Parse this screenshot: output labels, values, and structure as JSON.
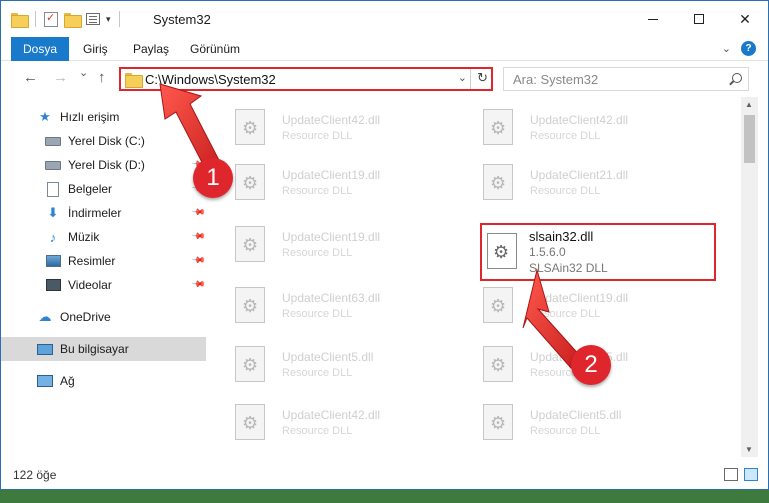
{
  "window": {
    "title": "System32",
    "controls": {
      "minimize": "",
      "maximize": "",
      "close": "✕"
    }
  },
  "ribbon": {
    "tabs": [
      "Dosya",
      "Giriş",
      "Paylaş",
      "Görünüm"
    ],
    "help": "?"
  },
  "navigation": {
    "back": "←",
    "forward": "→",
    "recent": "⌄",
    "up": "↑",
    "address": "C:\\Windows\\System32",
    "refresh": "↻",
    "search_placeholder": "Ara: System32"
  },
  "sidebar": {
    "items": [
      {
        "label": "Hızlı erişim",
        "icon": "star-icon",
        "pinned": false
      },
      {
        "label": "Yerel Disk (C:)",
        "icon": "disk-icon",
        "pinned": true
      },
      {
        "label": "Yerel Disk (D:)",
        "icon": "disk-icon",
        "pinned": true
      },
      {
        "label": "Belgeler",
        "icon": "document-icon",
        "pinned": true
      },
      {
        "label": "İndirmeler",
        "icon": "download-icon",
        "pinned": true
      },
      {
        "label": "Müzik",
        "icon": "music-icon",
        "pinned": true
      },
      {
        "label": "Resimler",
        "icon": "pictures-icon",
        "pinned": true
      },
      {
        "label": "Videolar",
        "icon": "video-icon",
        "pinned": true
      },
      {
        "label": "OneDrive",
        "icon": "cloud-icon",
        "pinned": false
      },
      {
        "label": "Bu bilgisayar",
        "icon": "computer-icon",
        "pinned": false,
        "selected": true
      },
      {
        "label": "Ağ",
        "icon": "network-icon",
        "pinned": false
      }
    ]
  },
  "files": {
    "left_column": [
      {
        "name": "UpdateClient42.dll",
        "type": "Resource DLL"
      },
      {
        "name": "UpdateClient19.dll",
        "type": "Resource DLL"
      },
      {
        "name": "UpdateClient19.dll",
        "type": "Resource DLL"
      },
      {
        "name": "UpdateClient63.dll",
        "type": "Resource DLL"
      },
      {
        "name": "UpdateClient5.dll",
        "type": "Resource DLL"
      },
      {
        "name": "UpdateClient42.dll",
        "type": "Resource DLL"
      }
    ],
    "right_column": [
      {
        "name": "UpdateClient42.dll",
        "type": "Resource DLL"
      },
      {
        "name": "UpdateClient21.dll",
        "type": "Resource DLL"
      },
      {
        "name": "UpdateClient19.dll",
        "type": "Resource DLL"
      },
      {
        "name": "UpdateClient65.dll",
        "type": "Resource DLL"
      },
      {
        "name": "UpdateClient5.dll",
        "type": "Resource DLL"
      }
    ],
    "highlighted": {
      "name": "slsain32.dll",
      "version": "1.5.6.0",
      "description": "SLSAin32 DLL"
    }
  },
  "status": {
    "item_count": "122 öğe"
  },
  "annotations": {
    "step1": "1",
    "step2": "2",
    "color": "#e0262d"
  }
}
